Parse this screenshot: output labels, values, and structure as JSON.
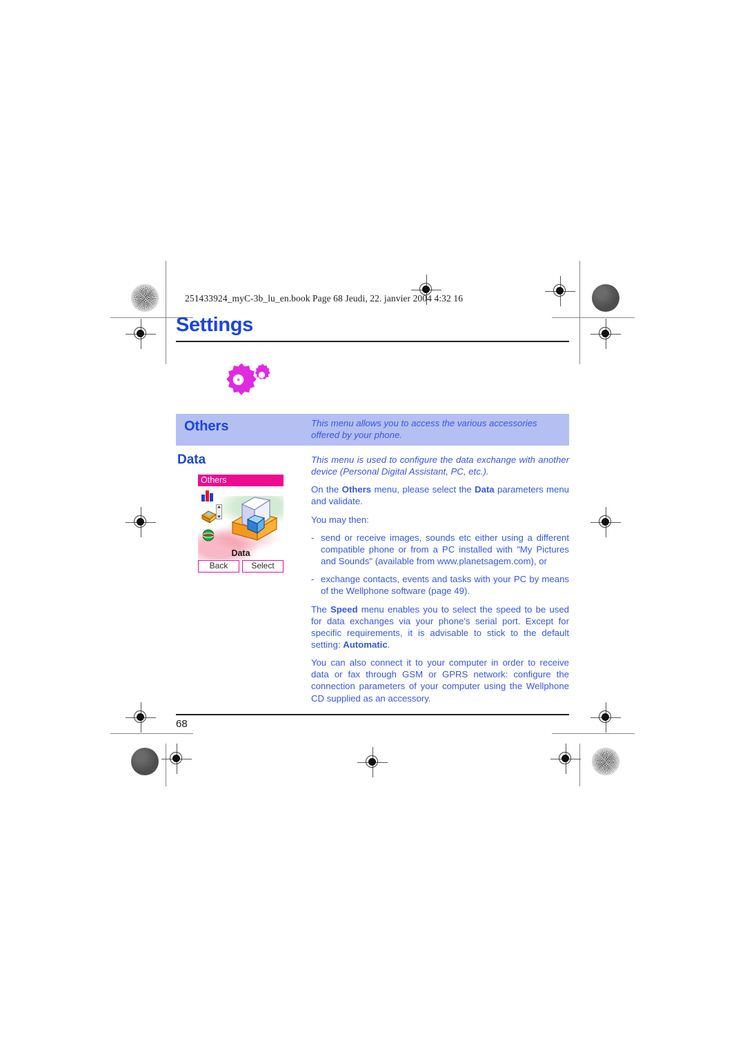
{
  "document": {
    "header_line": "251433924_myC-3b_lu_en.book  Page 68  Jeudi, 22. janvier 2004  4:32 16",
    "chapter_title": "Settings",
    "page_number": "68",
    "colors": {
      "heading_blue": "#1b44e0",
      "body_blue": "#3557e8",
      "band_background": "#b5bff2",
      "phone_magenta": "#ef0a90",
      "gear_magenta": "#e02ae0"
    }
  },
  "section": {
    "band_label": "Others",
    "band_text": "This menu allows you to access the various accessories offered by your phone.",
    "sub_title": "Data"
  },
  "phone_screen": {
    "title": "Others",
    "caption": "Data",
    "softkey_left": "Back",
    "softkey_right": "Select",
    "icons": [
      "bar-chart-icon",
      "inbox-tray-icon",
      "globe-icon"
    ],
    "main_icon": "open-box-documents-icon"
  },
  "body": {
    "intro_italic_line1": "This menu is used to configure the data exchange with another device",
    "intro_italic_line2": "(Personal Digital Assistant, PC, etc.).",
    "p_select_pre": "On the ",
    "p_select_b1": "Others",
    "p_select_mid": " menu, please select the ",
    "p_select_b2": "Data",
    "p_select_post": " parameters menu and validate.",
    "p_you_may": "You may then:",
    "bullet_dash": "-",
    "bullet_1": "send or receive images, sounds etc either using a different compatible phone or from a PC installed with \"My Pictures and Sounds\" (available from www.planetsagem.com), or",
    "bullet_2": "exchange contacts, events and tasks with your PC by means of the Wellphone software (page 49).",
    "p_speed_pre": "The ",
    "p_speed_b1": "Speed",
    "p_speed_mid": " menu enables you to select the speed to be used for data exchanges via your phone's serial port. Except for specific requirements, it is advisable to stick to the default setting: ",
    "p_speed_b2": "Automatic",
    "p_speed_post": ".",
    "p_connect": "You can also connect it to your computer in order to receive data or fax through GSM or GPRS network: configure the connection parameters of your computer using the Wellphone CD supplied as an accessory."
  }
}
